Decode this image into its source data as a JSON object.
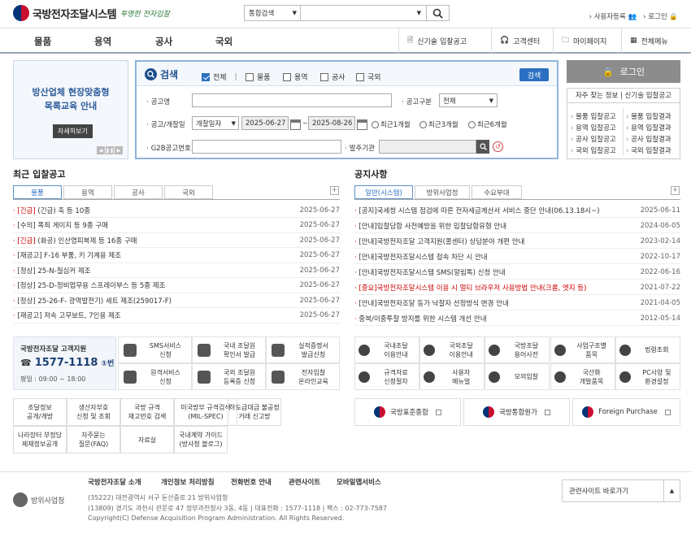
{
  "header": {
    "logo": "국방전자조달시스템",
    "slogan": "투명한 전자입찰",
    "search_select": "통합검색",
    "search_value": "",
    "util": [
      "사용자등록",
      "로그인"
    ]
  },
  "gnb": {
    "menu": [
      "물품",
      "용역",
      "공사",
      "국외"
    ],
    "right": [
      "신기술 입찰공고",
      "고객센터",
      "마이페이지",
      "전체메뉴"
    ]
  },
  "banner": {
    "title_line1": "방산업체 현장맞춤형",
    "title_line2": "목록교육 안내",
    "button": "자세히보기"
  },
  "search": {
    "title": "검색",
    "checks": [
      "전체",
      "물품",
      "용역",
      "공사",
      "국외"
    ],
    "button": "검색",
    "label_name": "공고명",
    "label_type": "공고구분",
    "type_value": "전체",
    "label_date": "공고/개찰일",
    "date_kind": "개찰일자",
    "date_from": "2025-06-27",
    "date_to": "2025-08-26",
    "radios": [
      "최근1개월",
      "최근3개월",
      "최근6개월"
    ],
    "label_g2b": "G2B공고번호",
    "label_agency": "발주기관"
  },
  "login": {
    "button": "로그인"
  },
  "faq": {
    "title": "자주 찾는 정보 | 신기술 입찰공고",
    "left": [
      "물품 입찰공고",
      "용역 입찰공고",
      "공사 입찰공고",
      "국외 입찰공고"
    ],
    "right": [
      "물품 입찰결과",
      "용역 입찰결과",
      "공사 입찰결과",
      "국외 입찰결과"
    ]
  },
  "bids": {
    "title": "최근 입찰공고",
    "tabs": [
      "물품",
      "용역",
      "공사",
      "국외"
    ],
    "rows": [
      {
        "tag": "[긴급]",
        "text": " (긴급) 축 등 10종",
        "date": "2025-06-27"
      },
      {
        "tag": "",
        "text": "[수의] 폭죄 게이지 등 9종 구매",
        "date": "2025-06-27"
      },
      {
        "tag": "[긴급]",
        "text": " (화공) 인산염피복제 등 16종 구매",
        "date": "2025-06-27"
      },
      {
        "tag": "",
        "text": "[재공고] F-16 부품, 키 기계용 제조",
        "date": "2025-06-27"
      },
      {
        "tag": "",
        "text": "[정상] 25-N-철심커 제조",
        "date": "2025-06-27"
      },
      {
        "tag": "",
        "text": "[정상] 25-D-정비업무용 스프레이부스 등 5종 제조",
        "date": "2025-06-27"
      },
      {
        "tag": "",
        "text": "[정상] 25-26-F- 광역발전기) 세트 제조(259017-F)",
        "date": "2025-06-27"
      },
      {
        "tag": "",
        "text": "[재공고] 저속 고무보트, 7인용 제조",
        "date": "2025-06-27"
      }
    ]
  },
  "notices": {
    "title": "공지사항",
    "tabs": [
      "일반(시스템)",
      "방위사업청",
      "수요부대"
    ],
    "rows": [
      {
        "text": "[공지]국세청 시스템 점검에 따른 전자세금계산서 서비스 중단 안내(06.13.18시~)",
        "date": "2025-06-11",
        "red": false
      },
      {
        "text": "[안내]입찰담합 사전예방을 위한 입찰담합유형 안내",
        "date": "2024-06-05",
        "red": false
      },
      {
        "text": "[안내]국방전자조달 고객지원(콜센터) 상담분야 개편 안내",
        "date": "2023-02-14",
        "red": false
      },
      {
        "text": "[안내]국방전자조달시스템 접속 차단 시 안내",
        "date": "2022-10-17",
        "red": false
      },
      {
        "text": "[안내]국방전자조달시스템 SMS(알림톡) 신청 안내",
        "date": "2022-06-16",
        "red": false
      },
      {
        "text": "[중요]국방전자조달시스템 이용 시 멀티 브라우저 사용방법 안내(크롬, 엣지 등)",
        "date": "2021-07-22",
        "red": true
      },
      {
        "text": "[안내]국방전자조달 동가 낙찰자 선정방식 변경 안내",
        "date": "2021-04-05",
        "red": false
      },
      {
        "text": "중복/이중투찰 방지를 위한 시스템 개선 안내",
        "date": "2012-05-14",
        "red": false
      }
    ]
  },
  "customer": {
    "title": "국방전자조달 고객지원",
    "phone": "1577-1118",
    "phone_suffix": "①번",
    "hours": "평일 : 09:00 ~ 18:00"
  },
  "services_left": [
    [
      "SMS서비스",
      "신청"
    ],
    [
      "국내 조달원",
      "확인서 발급"
    ],
    [
      "실적증명서",
      "발급신청"
    ],
    [
      "원격서비스",
      "신청"
    ],
    [
      "국외 조달원",
      "등록증 신청"
    ],
    [
      "전자입찰",
      "온라인교육"
    ]
  ],
  "services_right": [
    [
      "국내조달",
      "이용안내"
    ],
    [
      "국외조달",
      "이용안내"
    ],
    [
      "국방조달",
      "용어사전"
    ],
    [
      "사업구조별",
      "품목"
    ],
    [
      "법령조회",
      ""
    ],
    [
      "규격자료",
      "신청절차"
    ],
    [
      "사용자",
      "메뉴얼"
    ],
    [
      "모의입찰",
      ""
    ],
    [
      "국산화",
      "개발품목"
    ],
    [
      "PC사양 및",
      "환경설정"
    ]
  ],
  "links": [
    [
      "조달정보",
      "공개/개방"
    ],
    [
      "생산자부호",
      "신청 및 조회"
    ],
    [
      "국방 규격",
      "재고번호 검색"
    ],
    [
      "미국방부 규격검색",
      "(MIL-SPEC)"
    ],
    [
      "하도급대금 불공정",
      "거래 신고방"
    ],
    [
      "나라장터 부정당",
      "제재정보공개"
    ],
    [
      "자주묻는",
      "질문(FAQ)"
    ],
    [
      "자료실",
      ""
    ],
    [
      "국내계약 가이드",
      "(방사청 블로그)"
    ]
  ],
  "partner_banners": [
    "국방표준종합",
    "국방통합원가",
    "Foreign Purchase"
  ],
  "footer": {
    "links": [
      "국방전자조달 소개",
      "개인정보 처리방침",
      "전화번호 안내",
      "관련사이트",
      "모바일앱서비스"
    ],
    "org": "방위사업청",
    "addr1": "(35222) 대전광역시 서구 둔산중로 21 방위사업청",
    "addr2": "(13809) 경기도 과천시 관문로 47 정부과천청사 3동, 4동  |  대표전화 : 1577-1118  |  팩스 : 02-773-7587",
    "copyright": "Copyright(C) Defense Acquisition Program Administration. All Rights Reserved.",
    "related": "관련사이트 바로가기"
  }
}
